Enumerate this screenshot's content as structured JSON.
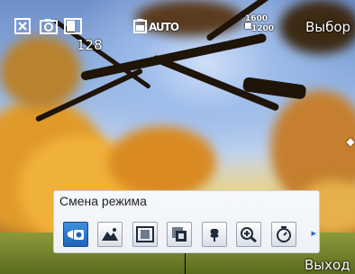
{
  "status_bar": {
    "close_icon": "close-icon",
    "camera_icon": "camera-icon",
    "white_balance_icon": "white-balance-icon",
    "shots_remaining": "128",
    "battery_icon": "battery-icon",
    "auto_flash_label": "AUTO",
    "resolution_top": "1600",
    "resolution_bottom": "1200",
    "resolution_prefix": "■"
  },
  "softkeys": {
    "left": "Выбор",
    "right": "Выход"
  },
  "mode_panel": {
    "title": "Смена режима",
    "modes": [
      {
        "name": "photo-mode",
        "icon": "camera-photo-icon",
        "selected": true
      },
      {
        "name": "landscape-mode",
        "icon": "mountain-icon",
        "selected": false
      },
      {
        "name": "frame-mode",
        "icon": "frame-icon",
        "selected": false
      },
      {
        "name": "panorama-mode",
        "icon": "panorama-icon",
        "selected": false
      },
      {
        "name": "macro-mode",
        "icon": "flower-icon",
        "selected": false
      },
      {
        "name": "zoom-mode",
        "icon": "zoom-icon",
        "selected": false
      },
      {
        "name": "timer-mode",
        "icon": "timer-icon",
        "selected": false
      }
    ],
    "more_arrow": "▸"
  },
  "colors": {
    "selected_mode": "#1f63b7",
    "panel_bg": "#f2f4f8",
    "softkey_text": "#ffffff"
  }
}
